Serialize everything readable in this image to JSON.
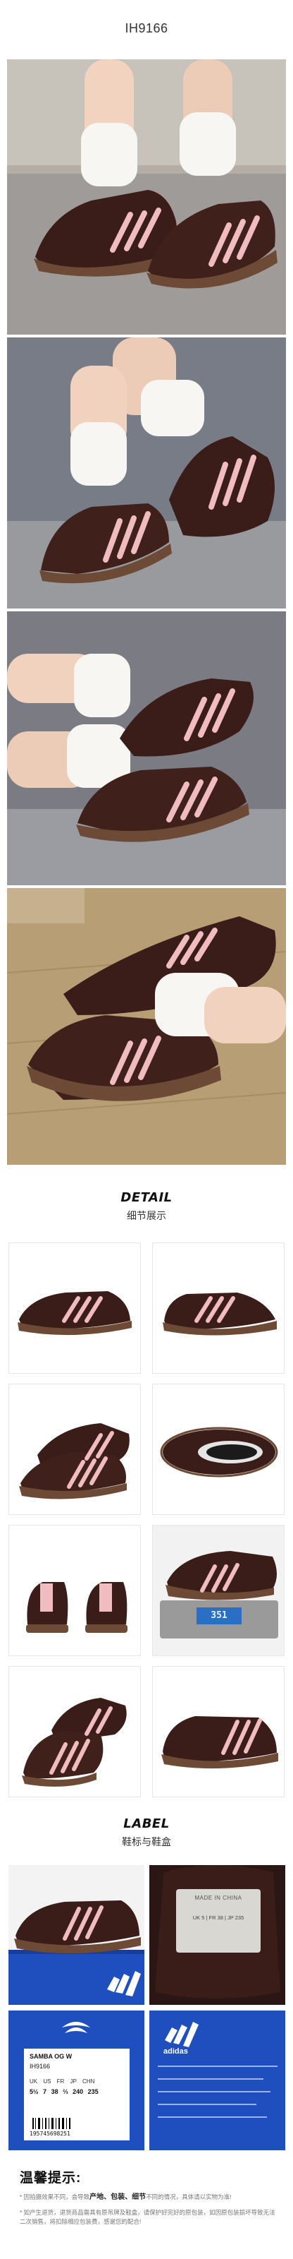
{
  "product_code": "IH9166",
  "detail_section": {
    "title_en": "DETAIL",
    "title_cn": "细节展示"
  },
  "label_section": {
    "title_en": "LABEL",
    "title_cn": "鞋标与鞋盒"
  },
  "label_box": {
    "model_name": "SAMBA OG W",
    "sku": "IH9166",
    "size_header": "UK US FR JP CHN",
    "size_values": [
      "5½",
      "7",
      "38 ⅔",
      "240",
      "235"
    ],
    "barcode_text": "195745698251",
    "brand_text": "adidas",
    "tongue_text": "MADE IN CHINA",
    "tongue_sizes": "UK 5 | FR 38 | JP 235",
    "scale_reading": "351"
  },
  "tips": {
    "title": "温馨提示:",
    "line1_pre": "* 因拍摄效果不同，会导致",
    "line1_bold": "产地、包装、细节",
    "line1_post": "不同的情况，具体请以实物为准!",
    "line2": "* 如产生退货，退货商品需具有原吊牌及鞋盒，请保护好完好的原包装，如因原包装损坏导致无法二次销售，将扣除相应包装费，感谢您的配合!"
  },
  "colors": {
    "shoe_suede": "#3a1c18",
    "stripe_pink": "#f0bcbf",
    "gum_sole": "#6d4a36",
    "box_blue": "#1f4fbf"
  }
}
